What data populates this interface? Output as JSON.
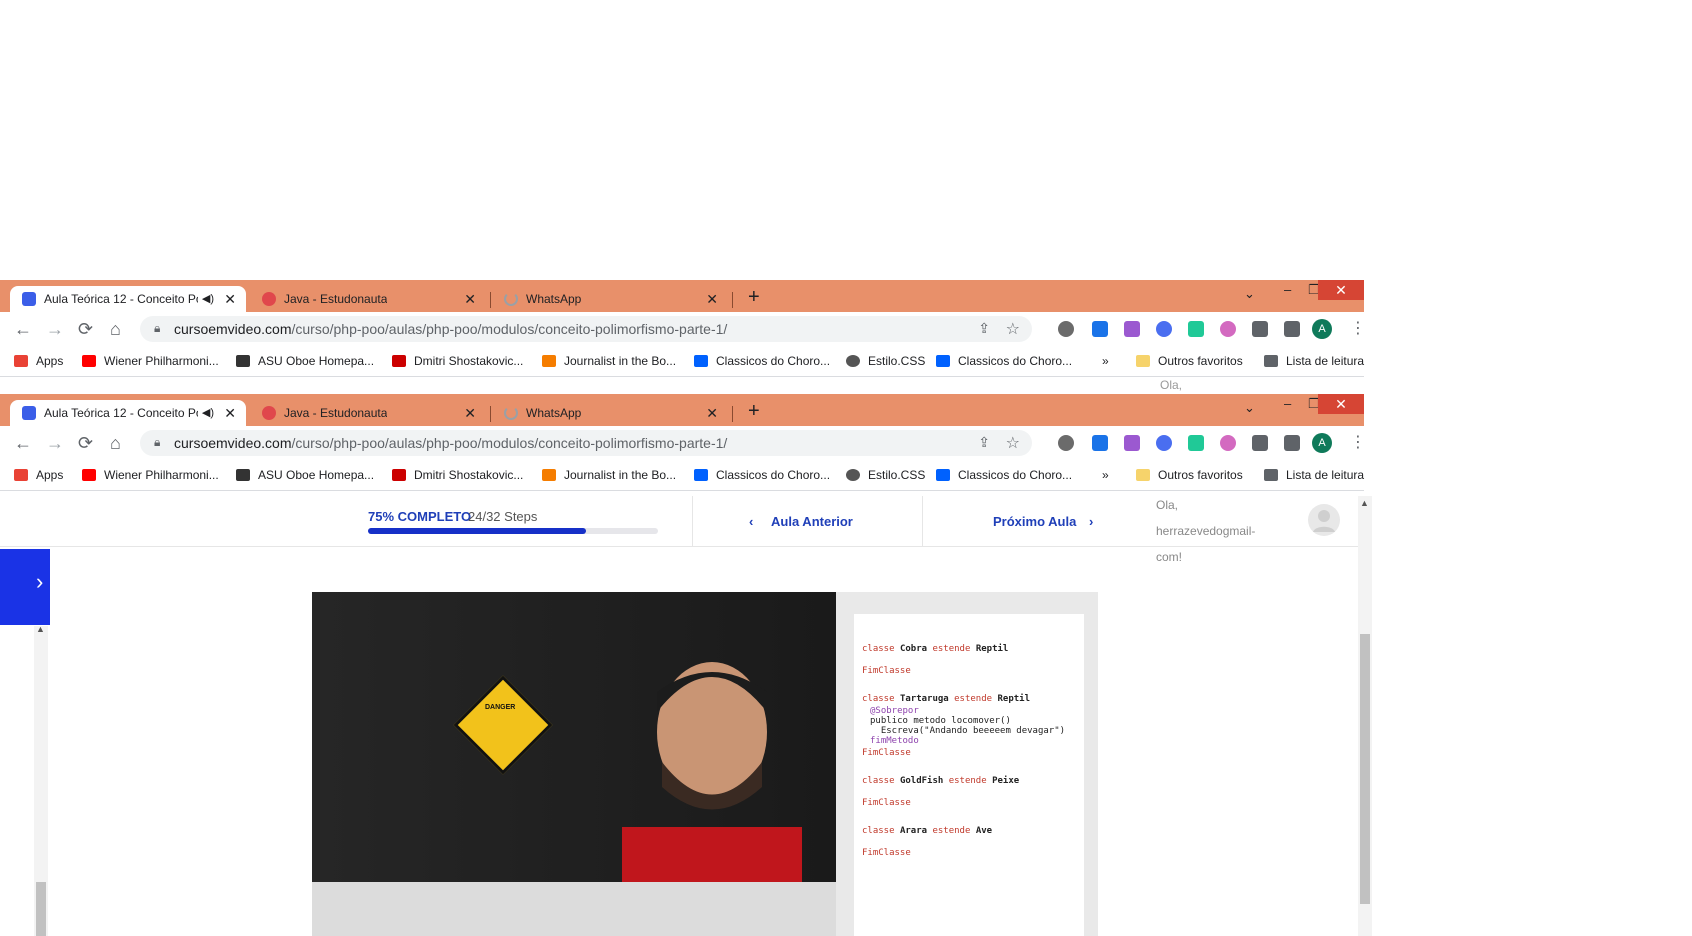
{
  "browser": {
    "tabs": [
      {
        "title": "Aula Teórica 12 - Conceito Po",
        "icon": "youtube-icon",
        "active": true,
        "muted_audio": true
      },
      {
        "title": "Java - Estudonauta",
        "icon": "estudonauta-icon",
        "active": false
      },
      {
        "title": "WhatsApp",
        "icon": "loading-spinner-icon",
        "active": false
      }
    ],
    "new_tab": "+",
    "tab_search": "⌄",
    "window": {
      "minimize": "–",
      "restore": "❐",
      "close": "✕"
    },
    "url": {
      "domain": "cursoemvideo.com",
      "path": "/curso/php-poo/aulas/php-poo/modulos/conceito-polimorfismo-parte-1/"
    },
    "nav": {
      "back": "←",
      "forward": "→",
      "reload": "⟳",
      "home": "⌂"
    },
    "profile_initial": "A",
    "bookmarks": [
      {
        "label": "Apps",
        "icon": "apps-grid-icon",
        "color": "#e94235"
      },
      {
        "label": "Wiener Philharmoni...",
        "icon": "youtube-icon",
        "color": "#ff0000"
      },
      {
        "label": "ASU Oboe Homepa...",
        "icon": "asu-icon",
        "color": "#333333"
      },
      {
        "label": "Dmitri Shostakovic...",
        "icon": "youtube-icon",
        "color": "#cc0000"
      },
      {
        "label": "Journalist in the Bo...",
        "icon": "blogger-icon",
        "color": "#f57d00"
      },
      {
        "label": "Classicos do Choro...",
        "icon": "dropbox-icon",
        "color": "#0061fe"
      },
      {
        "label": "Estilo.CSS",
        "icon": "globe-icon",
        "color": "#555555"
      },
      {
        "label": "Classicos do Choro...",
        "icon": "dropbox-icon",
        "color": "#0061fe"
      }
    ],
    "overflow": "»",
    "other_bookmarks": "Outros favoritos",
    "reading_list": "Lista de leitura"
  },
  "page": {
    "progress_label": "75% COMPLETO",
    "steps_label": "24/32 Steps",
    "progress_fraction": 0.75,
    "prev_lesson": "Aula Anterior",
    "next_lesson": "Próximo Aula",
    "greeting_top": "Ola,",
    "greeting_user": "herrazevedogmail-",
    "greeting_end": "com!"
  },
  "video": {
    "code_lines": [
      {
        "kw1": "classe ",
        "name": "Cobra",
        "kw2": " estende ",
        "parent": "Reptil"
      },
      {
        "end": "FimClasse"
      },
      {
        "kw1": "classe ",
        "name": "Tartaruga",
        "kw2": " estende ",
        "parent": "Reptil"
      },
      {
        "annot": "@Sobrepor"
      },
      {
        "plain": "publico metodo locomover()"
      },
      {
        "plain": "  Escreva(\"Andando beeeeem devagar\")"
      },
      {
        "annot": "fimMetodo"
      },
      {
        "end": "FimClasse"
      },
      {
        "kw1": "classe ",
        "name": "GoldFish",
        "kw2": " estende ",
        "parent": "Peixe"
      },
      {
        "end": "FimClasse"
      },
      {
        "kw1": "classe ",
        "name": "Arara",
        "kw2": " estende ",
        "parent": "Ave"
      },
      {
        "end": "FimClasse"
      }
    ],
    "sign_text": "DANGER"
  }
}
